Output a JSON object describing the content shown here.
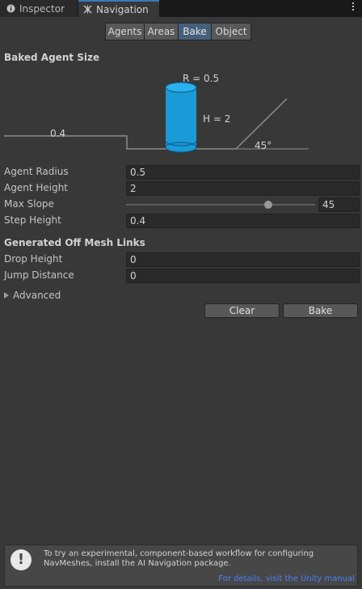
{
  "tabs": [
    {
      "label": "Inspector",
      "icon": "info-icon"
    },
    {
      "label": "Navigation",
      "icon": "navigation-icon"
    }
  ],
  "segments": [
    {
      "label": "Agents",
      "active": false
    },
    {
      "label": "Areas",
      "active": false
    },
    {
      "label": "Bake",
      "active": true
    },
    {
      "label": "Object",
      "active": false
    }
  ],
  "baked_agent_size": {
    "title": "Baked Agent Size",
    "radius_label": "R = 0.5",
    "height_label": "H = 2",
    "step_label": "0.4",
    "slope_label": "45°"
  },
  "fields": {
    "agent_radius": {
      "label": "Agent Radius",
      "value": "0.5"
    },
    "agent_height": {
      "label": "Agent Height",
      "value": "2"
    },
    "max_slope": {
      "label": "Max Slope",
      "value": "45",
      "min": 0,
      "max": 60,
      "level": 45
    },
    "step_height": {
      "label": "Step Height",
      "value": "0.4"
    }
  },
  "offmesh": {
    "title": "Generated Off Mesh Links",
    "drop_height": {
      "label": "Drop Height",
      "value": "0"
    },
    "jump_distance": {
      "label": "Jump Distance",
      "value": "0"
    }
  },
  "advanced": {
    "label": "Advanced"
  },
  "buttons": {
    "clear": "Clear",
    "bake": "Bake"
  },
  "help": {
    "icon": "exclamation-icon",
    "text": "To try an experimental, component-based workflow for configuring NavMeshes, install the AI Navigation package.",
    "link": "For details, visit the Unity manual"
  },
  "colors": {
    "accent": "#3a79bb",
    "agent_cylinder": "#1a9ad6",
    "link": "#4c7eff"
  }
}
